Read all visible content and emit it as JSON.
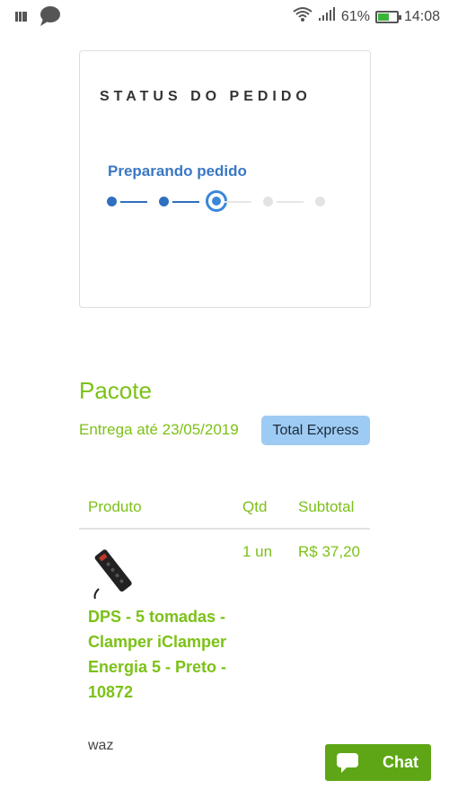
{
  "status_bar": {
    "battery_percent": "61%",
    "battery_level": 0.61,
    "time": "14:08",
    "icons": [
      "notes-icon",
      "chat-bubble-icon",
      "wifi-icon",
      "signal-icon",
      "battery-icon"
    ]
  },
  "order_status": {
    "title": "STATUS DO PEDIDO",
    "current_step_label": "Preparando pedido",
    "total_steps": 5,
    "current_step": 3
  },
  "package": {
    "title": "Pacote",
    "delivery": "Entrega até 23/05/2019",
    "carrier": "Total Express"
  },
  "table": {
    "headers": {
      "product": "Produto",
      "qty": "Qtd",
      "subtotal": "Subtotal"
    },
    "rows": [
      {
        "name": "DPS - 5 tomadas - Clamper iClamper Energia 5 - Preto - 10872",
        "qty": "1 un",
        "subtotal": "R$ 37,20",
        "note": "waz"
      }
    ]
  },
  "chat": {
    "label": "Chat"
  },
  "colors": {
    "brand_green": "#7cc117",
    "chat_green": "#5ea615",
    "step_blue": "#2f6fbf",
    "badge_blue": "#9ecbf3"
  }
}
